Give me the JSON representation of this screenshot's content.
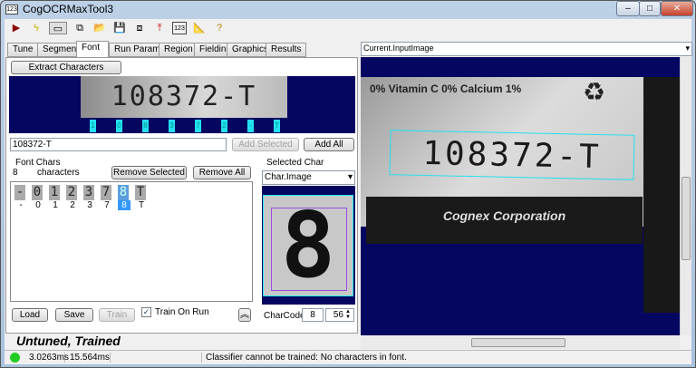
{
  "window": {
    "title": "CogOCRMaxTool3",
    "min": "–",
    "max": "□",
    "close": "✕"
  },
  "toolbar": [
    "run-icon",
    "lightning-icon",
    "show-image-icon",
    "floating-icon",
    "open-icon",
    "save-icon",
    "reset-icon",
    "import-icon",
    "ocr-icon",
    "measure-icon",
    "help-icon"
  ],
  "tabs": [
    "Tune",
    "Segment",
    "Font",
    "Run Params",
    "Region",
    "Fielding",
    "Graphics",
    "Results"
  ],
  "active_tab": "Font",
  "extract_button": "Extract Characters",
  "extracted_labels": [
    "1",
    "0",
    "8",
    "3",
    "7",
    "2",
    "-",
    "T"
  ],
  "text_input": "108372-T",
  "add_selected": "Add Selected",
  "add_all": "Add All",
  "font_chars": {
    "group": "Font Chars",
    "count": "8",
    "count_label": "characters",
    "remove_selected": "Remove Selected",
    "remove_all": "Remove All",
    "chars": [
      "-",
      "0",
      "1",
      "2",
      "3",
      "7",
      "8",
      "T"
    ],
    "selected": "8"
  },
  "selected_char": {
    "group": "Selected Char",
    "dropdown": "Char.Image",
    "charcode_label": "CharCode:",
    "charcode_char": "8",
    "charcode_value": "56"
  },
  "buttons": {
    "load": "Load",
    "save": "Save",
    "train": "Train",
    "train_on_run": "Train On Run",
    "train_on_run_checked": true,
    "collapse": "«"
  },
  "status_text": "Untuned, Trained",
  "statusbar": {
    "time1": "3.0263ms",
    "time2": "15.564ms",
    "message": "Classifier cannot be trained: No characters in font.",
    "indicator_color": "#22cc22"
  },
  "image_view": {
    "dropdown": "Current.InputImage",
    "label_text": "0%  Vitamin C 0%  Calcium 1%",
    "ocr_text": "108372-T",
    "brand": "Cognex Corporation",
    "region_color": "#22e0f0"
  }
}
